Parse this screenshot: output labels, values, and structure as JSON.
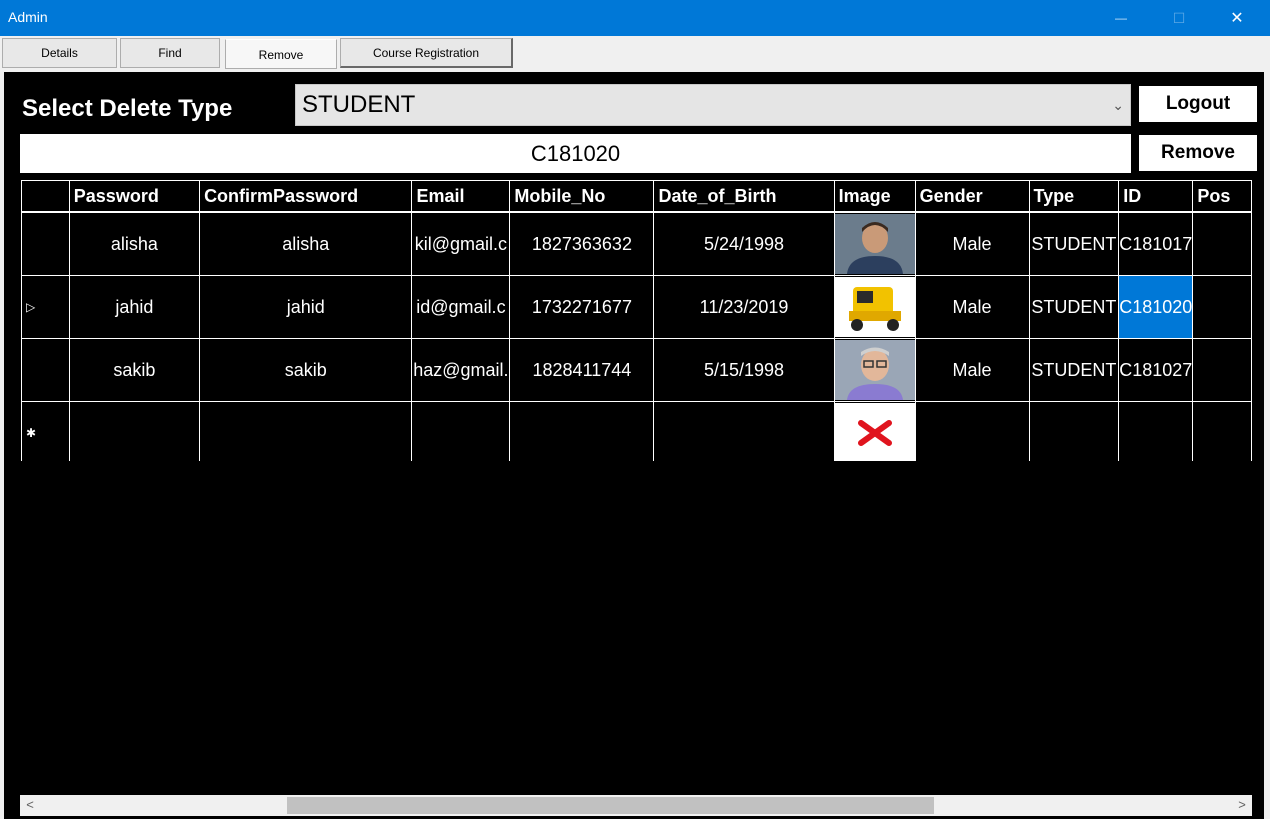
{
  "window": {
    "title": "Admin",
    "minimize_glyph": "—",
    "maximize_glyph": "☐",
    "close_glyph": "✕"
  },
  "tabs": [
    "Details",
    "Find",
    "Remove",
    "Course Registration"
  ],
  "remove": {
    "delete_type_label": "Select Delete Type",
    "delete_type_value": "STUDENT",
    "logout_label": "Logout",
    "remove_label": "Remove",
    "id_value": "C181020"
  },
  "grid": {
    "columns": [
      "Password",
      "ConfirmPassword",
      "Email",
      "Mobile_No",
      "Date_of_Birth",
      "Image",
      "Gender",
      "Type",
      "ID",
      "Pos"
    ],
    "rows": [
      {
        "marker": "",
        "password": "alisha",
        "confirm": "alisha",
        "email": "kil@gmail.c",
        "mobile": "1827363632",
        "dob": "5/24/1998",
        "image": "portrait-man-dark-hair",
        "gender": "Male",
        "type": "STUDENT",
        "id": "C181017",
        "selected_id": false
      },
      {
        "marker": "▷",
        "password": "jahid",
        "confirm": "jahid",
        "email": "id@gmail.c",
        "mobile": "1732271677",
        "dob": "11/23/2019",
        "image": "yellow-auto-rickshaw",
        "gender": "Male",
        "type": "STUDENT",
        "id": "C181020",
        "selected_id": true
      },
      {
        "marker": "",
        "password": "sakib",
        "confirm": "sakib",
        "email": "haz@gmail.",
        "mobile": "1828411744",
        "dob": "5/15/1998",
        "image": "portrait-man-glasses",
        "gender": "Male",
        "type": "STUDENT",
        "id": "C181027",
        "selected_id": false
      },
      {
        "marker": "✱",
        "password": "",
        "confirm": "",
        "email": "",
        "mobile": "",
        "dob": "",
        "image": "missing-image-red-x",
        "gender": "",
        "type": "",
        "id": "",
        "selected_id": false
      }
    ]
  },
  "scroll": {
    "left_glyph": "<",
    "right_glyph": ">"
  }
}
